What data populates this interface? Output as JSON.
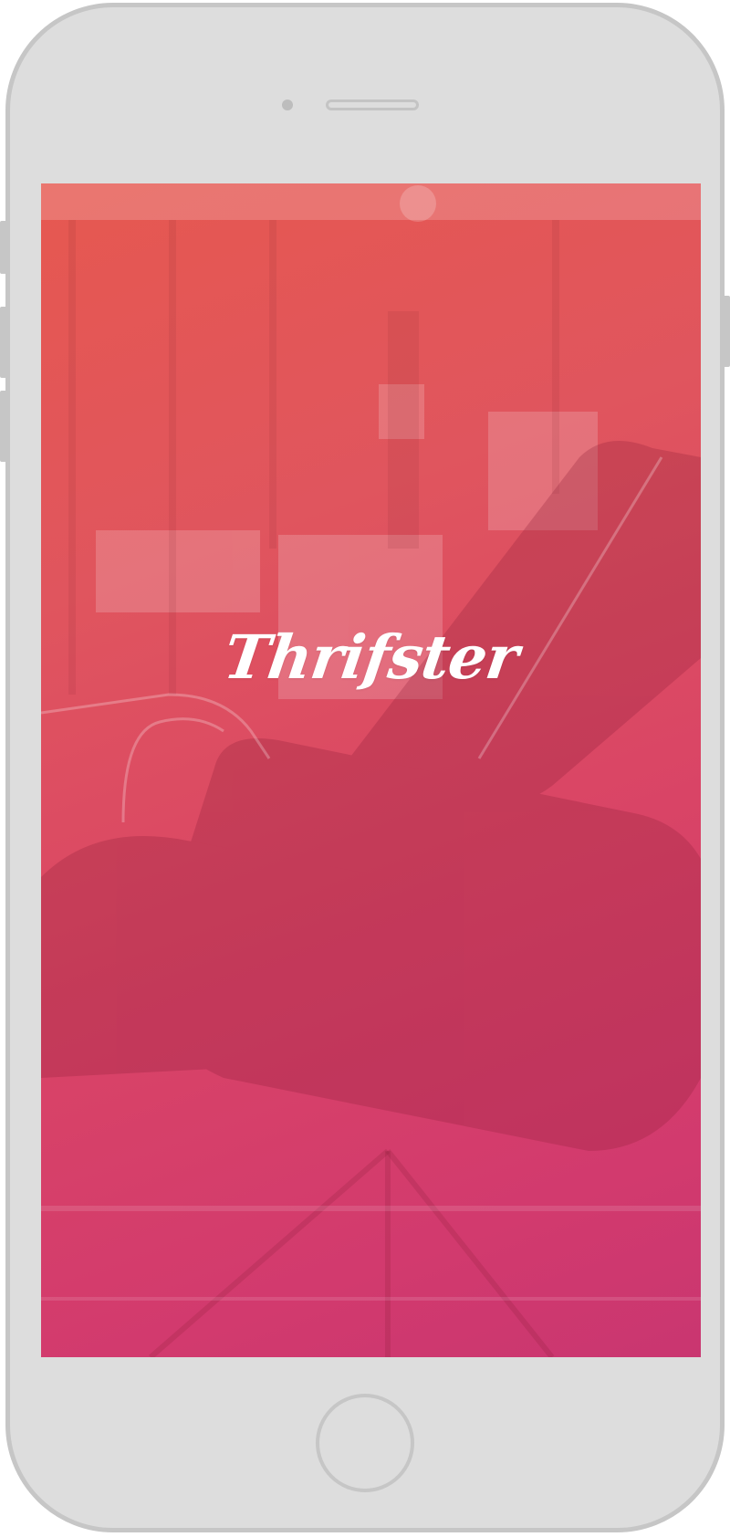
{
  "app": {
    "logo_text": "Thrifster"
  },
  "colors": {
    "gradient_top": "#e65850",
    "gradient_bottom": "#c93670",
    "device_frame": "#dddddd",
    "device_border": "#c6c6c6",
    "logo_color": "#ffffff"
  },
  "icons": {
    "background_image": "lounge-chair-photo",
    "home": "home-button"
  }
}
